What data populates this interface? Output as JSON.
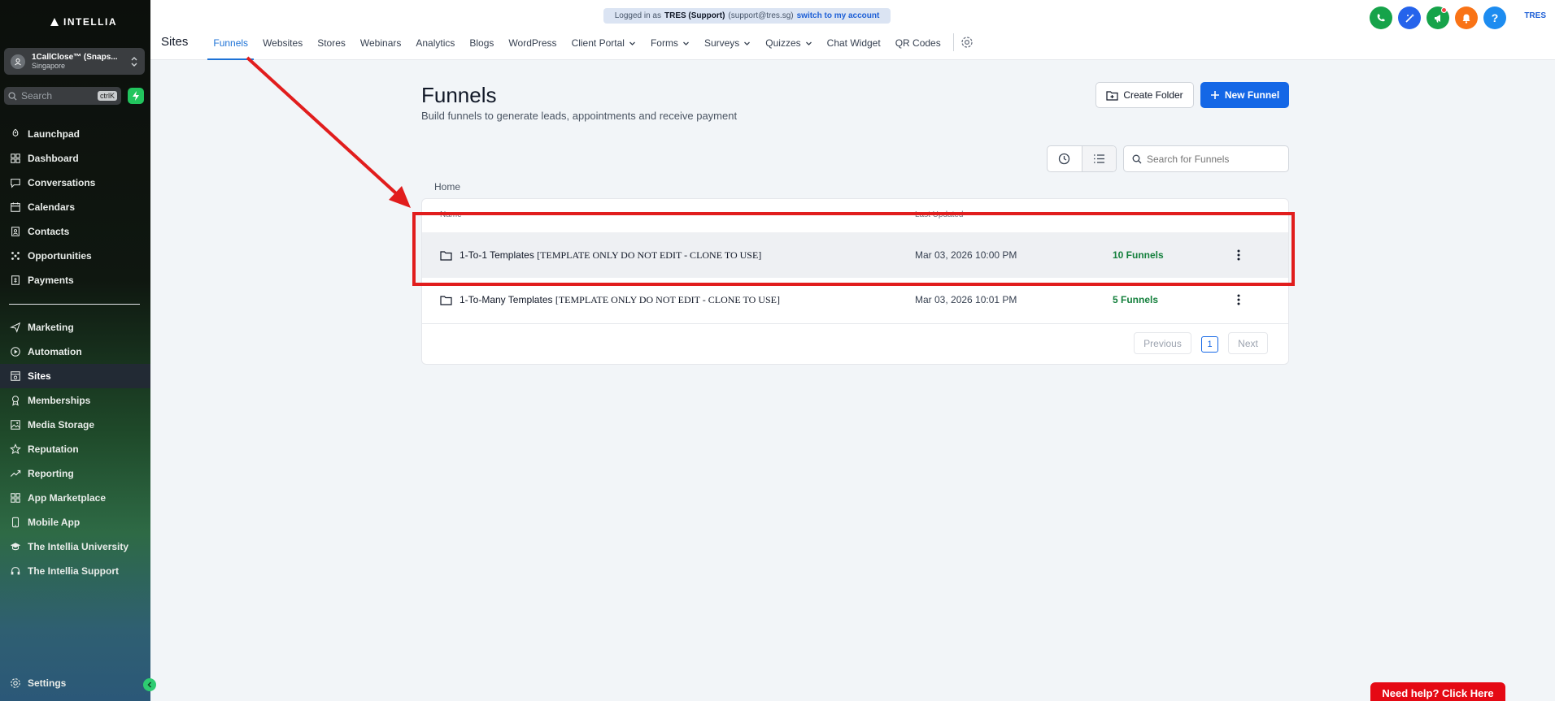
{
  "sidebar": {
    "logo_text": "INTELLIA",
    "account_name": "1CallClose™ (Snaps...",
    "account_location": "Singapore",
    "search_placeholder": "Search",
    "search_shortcut": "ctrlK",
    "nav_primary": [
      {
        "label": "Launchpad",
        "icon": "rocket-icon"
      },
      {
        "label": "Dashboard",
        "icon": "grid-icon"
      },
      {
        "label": "Conversations",
        "icon": "chat-icon"
      },
      {
        "label": "Calendars",
        "icon": "calendar-icon"
      },
      {
        "label": "Contacts",
        "icon": "contacts-icon"
      },
      {
        "label": "Opportunities",
        "icon": "opportunities-icon"
      },
      {
        "label": "Payments",
        "icon": "payments-icon"
      }
    ],
    "nav_secondary": [
      {
        "label": "Marketing",
        "icon": "send-icon"
      },
      {
        "label": "Automation",
        "icon": "automation-icon"
      },
      {
        "label": "Sites",
        "icon": "sites-icon",
        "active": true
      },
      {
        "label": "Memberships",
        "icon": "award-icon"
      },
      {
        "label": "Media Storage",
        "icon": "image-icon"
      },
      {
        "label": "Reputation",
        "icon": "star-icon"
      },
      {
        "label": "Reporting",
        "icon": "trend-icon"
      },
      {
        "label": "App Marketplace",
        "icon": "apps-icon"
      },
      {
        "label": "Mobile App",
        "icon": "phone-icon"
      },
      {
        "label": "The Intellia University",
        "icon": "graduation-icon"
      },
      {
        "label": "The Intellia Support",
        "icon": "headset-icon"
      }
    ],
    "settings_label": "Settings"
  },
  "header": {
    "banner_prefix": "Logged in as",
    "banner_user": "TRES (Support)",
    "banner_email": "(support@tres.sg)",
    "banner_switch": "switch to my account",
    "user_initials": "TRES",
    "section_title": "Sites",
    "tabs": [
      {
        "label": "Funnels",
        "active": true,
        "dropdown": false
      },
      {
        "label": "Websites",
        "dropdown": false
      },
      {
        "label": "Stores",
        "dropdown": false
      },
      {
        "label": "Webinars",
        "dropdown": false
      },
      {
        "label": "Analytics",
        "dropdown": false
      },
      {
        "label": "Blogs",
        "dropdown": false
      },
      {
        "label": "WordPress",
        "dropdown": false
      },
      {
        "label": "Client Portal",
        "dropdown": true
      },
      {
        "label": "Forms",
        "dropdown": true
      },
      {
        "label": "Surveys",
        "dropdown": true
      },
      {
        "label": "Quizzes",
        "dropdown": true
      },
      {
        "label": "Chat Widget",
        "dropdown": false
      },
      {
        "label": "QR Codes",
        "dropdown": false
      }
    ],
    "icon_colors": {
      "phone": "#16a34a",
      "magic": "#2563eb",
      "announce": "#16a34a",
      "bell": "#f97316",
      "help": "#1d8cf0"
    }
  },
  "main": {
    "title": "Funnels",
    "subtitle": "Build funnels to generate leads, appointments and receive payment",
    "create_folder_label": "Create Folder",
    "new_funnel_label": "New Funnel",
    "search_placeholder": "Search for Funnels",
    "breadcrumb": "Home",
    "columns": {
      "name": "Name",
      "updated": "Last Updated"
    },
    "rows": [
      {
        "name": "1-To-1 Templates",
        "tag": "[TEMPLATE ONLY DO NOT EDIT - CLONE TO USE]",
        "updated": "Mar 03, 2026 10:00 PM",
        "count": "10 Funnels"
      },
      {
        "name": "1-To-Many Templates",
        "tag": "[TEMPLATE ONLY DO NOT EDIT - CLONE TO USE]",
        "updated": "Mar 03, 2026 10:01 PM",
        "count": "5 Funnels"
      }
    ],
    "pagination": {
      "previous": "Previous",
      "current": "1",
      "next": "Next"
    }
  },
  "help_button": "Need help? Click Here",
  "colors": {
    "accent": "#1467e6",
    "annotation": "#e11d1d",
    "count_green": "#15803d"
  }
}
